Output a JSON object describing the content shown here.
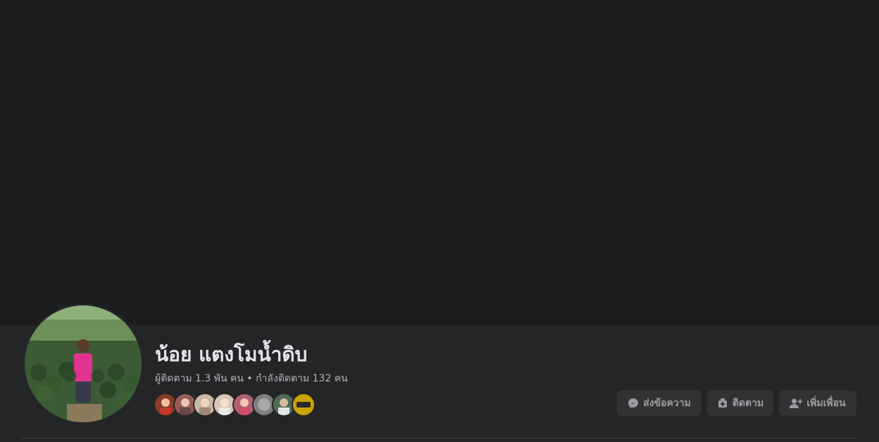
{
  "profile": {
    "name": "น้อย แตงโมน้ำดิบ",
    "followers_text": "ผู้ติดตาม 1.3 พัน คน • กำลังติดตาม 132 คน",
    "avatar_icon": "profile-photo-watermelon-field"
  },
  "mutual_friends": [
    {
      "icon": "friend-avatar-1",
      "color": "#8a3b2a"
    },
    {
      "icon": "friend-avatar-2",
      "color": "#9b5b5b"
    },
    {
      "icon": "friend-avatar-3",
      "color": "#c9b7a6"
    },
    {
      "icon": "friend-avatar-4",
      "color": "#d8c4b6"
    },
    {
      "icon": "friend-avatar-5",
      "color": "#b06070"
    },
    {
      "icon": "friend-avatar-6",
      "color": "#7f7f7f"
    },
    {
      "icon": "friend-avatar-7",
      "color": "#4f6a55"
    },
    {
      "icon": "friend-avatar-8",
      "color": "#c9a400"
    }
  ],
  "actions": {
    "message_label": "ส่งข้อความ",
    "follow_label": "ติดตาม",
    "add_friend_label": "เพิ่มเพื่อน"
  },
  "colors": {
    "background": "#18191a",
    "panel": "#242526",
    "button": "#3a3b3c",
    "text_primary": "#e4e6eb",
    "text_secondary": "#b0b3b8"
  }
}
